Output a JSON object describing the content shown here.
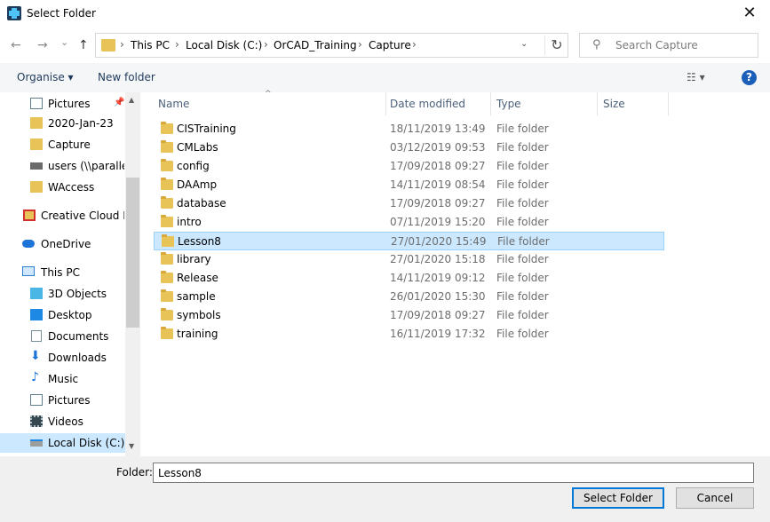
{
  "window": {
    "title": "Select Folder",
    "close_glyph": "✕"
  },
  "nav": {
    "back_glyph": "←",
    "forward_glyph": "→",
    "recent_glyph": "⌄",
    "up_glyph": "↑",
    "breadcrumb": [
      "This PC",
      "Local Disk (C:)",
      "OrCAD_Training",
      "Capture"
    ],
    "separator": "›",
    "dropdown_glyph": "⌄",
    "refresh_glyph": "↻",
    "search_placeholder": "Search Capture",
    "search_icon_glyph": "⚲"
  },
  "toolbar": {
    "organise": "Organise ▾",
    "new_folder": "New folder",
    "view_glyph": "☷ ▾",
    "help": "?"
  },
  "sidebar": {
    "items": [
      {
        "label": "Pictures",
        "icon": "pictures-icon",
        "pinned": true
      },
      {
        "label": "2020-Jan-23",
        "icon": "folder-icon"
      },
      {
        "label": "Capture",
        "icon": "folder-icon"
      },
      {
        "label": "users (\\\\parallelr",
        "icon": "network-drive-icon"
      },
      {
        "label": "WAccess",
        "icon": "folder-icon"
      },
      {
        "label": "Creative Cloud Fil",
        "icon": "creative-cloud-icon"
      },
      {
        "label": "OneDrive",
        "icon": "onedrive-icon"
      },
      {
        "label": "This PC",
        "icon": "this-pc-icon"
      },
      {
        "label": "3D Objects",
        "icon": "3d-objects-icon"
      },
      {
        "label": "Desktop",
        "icon": "desktop-icon"
      },
      {
        "label": "Documents",
        "icon": "documents-icon"
      },
      {
        "label": "Downloads",
        "icon": "downloads-icon"
      },
      {
        "label": "Music",
        "icon": "music-icon"
      },
      {
        "label": "Pictures",
        "icon": "pictures-icon"
      },
      {
        "label": "Videos",
        "icon": "videos-icon"
      },
      {
        "label": "Local Disk (C:)",
        "icon": "local-disk-icon",
        "selected": true
      }
    ],
    "pin_glyph": "📌",
    "scroll_up_glyph": "▲",
    "scroll_down_glyph": "▼"
  },
  "list": {
    "columns": [
      "Name",
      "Date modified",
      "Type",
      "Size"
    ],
    "sort_glyph": "^",
    "rows": [
      {
        "name": "CISTraining",
        "date": "18/11/2019 13:49",
        "type": "File folder"
      },
      {
        "name": "CMLabs",
        "date": "03/12/2019 09:53",
        "type": "File folder"
      },
      {
        "name": "config",
        "date": "17/09/2018 09:27",
        "type": "File folder"
      },
      {
        "name": "DAAmp",
        "date": "14/11/2019 08:54",
        "type": "File folder"
      },
      {
        "name": "database",
        "date": "17/09/2018 09:27",
        "type": "File folder"
      },
      {
        "name": "intro",
        "date": "07/11/2019 15:20",
        "type": "File folder"
      },
      {
        "name": "Lesson8",
        "date": "27/01/2020 15:49",
        "type": "File folder",
        "selected": true
      },
      {
        "name": "library",
        "date": "27/01/2020 15:18",
        "type": "File folder"
      },
      {
        "name": "Release",
        "date": "14/11/2019 09:12",
        "type": "File folder"
      },
      {
        "name": "sample",
        "date": "26/01/2020 15:30",
        "type": "File folder"
      },
      {
        "name": "symbols",
        "date": "17/09/2018 09:27",
        "type": "File folder"
      },
      {
        "name": "training",
        "date": "16/11/2019 17:32",
        "type": "File folder"
      }
    ]
  },
  "footer": {
    "folder_label": "Folder:",
    "folder_value": "Lesson8",
    "select_button": "Select Folder",
    "cancel_button": "Cancel"
  },
  "colors": {
    "accent": "#0078d7",
    "selection": "#cce8ff",
    "folder": "#e8c458"
  }
}
